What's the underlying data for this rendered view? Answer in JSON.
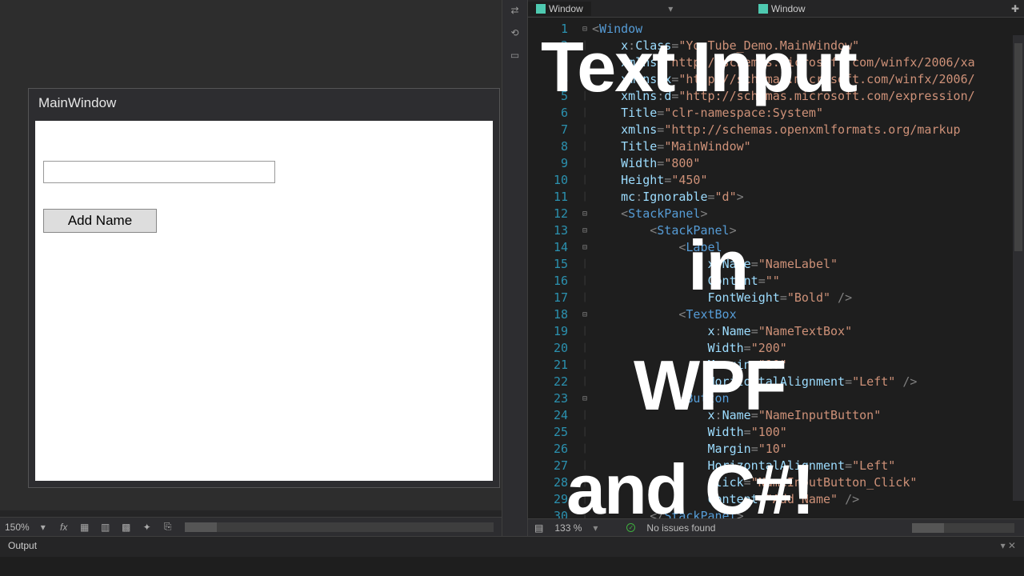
{
  "tabs": {
    "left": "Window",
    "right": "Window"
  },
  "wpf": {
    "title": "MainWindow",
    "button_label": "Add Name"
  },
  "designer_status": {
    "zoom": "150%"
  },
  "code_status": {
    "zoom": "133 %",
    "issues": "No issues found"
  },
  "bottom": {
    "label": "Output"
  },
  "overlay": {
    "line1": "Text Input",
    "line2": "in",
    "line3": "WPF",
    "line4": "and C#!"
  },
  "code": {
    "lines": [
      {
        "n": 1,
        "fold": "⊟",
        "seg": [
          [
            "<",
            "punc"
          ],
          [
            "Window",
            "tag"
          ]
        ]
      },
      {
        "n": 2,
        "seg": [
          [
            "    ",
            ""
          ],
          [
            "x",
            "attr"
          ],
          [
            ":",
            "punc"
          ],
          [
            "Class",
            "attr"
          ],
          [
            "=",
            "punc"
          ],
          [
            "\"YouTube_Demo.MainWindow\"",
            "str"
          ]
        ]
      },
      {
        "n": 3,
        "seg": [
          [
            "    ",
            ""
          ],
          [
            "xmlns",
            "attr"
          ],
          [
            "=",
            "punc"
          ],
          [
            "\"http://schemas.microsoft.com/winfx/2006/xa",
            "str"
          ]
        ]
      },
      {
        "n": 4,
        "seg": [
          [
            "    ",
            ""
          ],
          [
            "xmlns",
            "attr"
          ],
          [
            ":",
            "punc"
          ],
          [
            "x",
            "attr"
          ],
          [
            "=",
            "punc"
          ],
          [
            "\"http://schemas.microsoft.com/winfx/2006/",
            "str"
          ]
        ]
      },
      {
        "n": 5,
        "seg": [
          [
            "    ",
            ""
          ],
          [
            "xmlns",
            "attr"
          ],
          [
            ":",
            "punc"
          ],
          [
            "d",
            "attr"
          ],
          [
            "=",
            "punc"
          ],
          [
            "\"http://schemas.microsoft.com/expression/",
            "str"
          ]
        ]
      },
      {
        "n": 6,
        "seg": [
          [
            "    ",
            ""
          ],
          [
            "Title",
            "attr"
          ],
          [
            "=",
            "punc"
          ],
          [
            "\"clr-namespace:System\"",
            "str"
          ]
        ]
      },
      {
        "n": 7,
        "seg": [
          [
            "    ",
            ""
          ],
          [
            "xmlns",
            "attr"
          ],
          [
            "=",
            "punc"
          ],
          [
            "\"http://schemas.openxmlformats.org/markup",
            "str"
          ]
        ]
      },
      {
        "n": 8,
        "seg": [
          [
            "    ",
            ""
          ],
          [
            "Title",
            "attr"
          ],
          [
            "=",
            "punc"
          ],
          [
            "\"MainWindow\"",
            "str"
          ]
        ]
      },
      {
        "n": 9,
        "seg": [
          [
            "    ",
            ""
          ],
          [
            "Width",
            "attr"
          ],
          [
            "=",
            "punc"
          ],
          [
            "\"800\"",
            "str"
          ]
        ]
      },
      {
        "n": 10,
        "seg": [
          [
            "    ",
            ""
          ],
          [
            "Height",
            "attr"
          ],
          [
            "=",
            "punc"
          ],
          [
            "\"450\"",
            "str"
          ]
        ]
      },
      {
        "n": 11,
        "seg": [
          [
            "    ",
            ""
          ],
          [
            "mc",
            "attr"
          ],
          [
            ":",
            "punc"
          ],
          [
            "Ignorable",
            "attr"
          ],
          [
            "=",
            "punc"
          ],
          [
            "\"d\"",
            "str"
          ],
          [
            ">",
            "punc"
          ]
        ]
      },
      {
        "n": 12,
        "fold": "⊟",
        "seg": [
          [
            "    ",
            ""
          ],
          [
            "<",
            "punc"
          ],
          [
            "StackPanel",
            "tag"
          ],
          [
            ">",
            "punc"
          ]
        ]
      },
      {
        "n": 13,
        "fold": "⊟",
        "seg": [
          [
            "        ",
            ""
          ],
          [
            "<",
            "punc"
          ],
          [
            "StackPanel",
            "tag"
          ],
          [
            ">",
            "punc"
          ]
        ]
      },
      {
        "n": 14,
        "fold": "⊟",
        "seg": [
          [
            "            ",
            ""
          ],
          [
            "<",
            "punc"
          ],
          [
            "Label",
            "tag"
          ]
        ]
      },
      {
        "n": 15,
        "seg": [
          [
            "                ",
            ""
          ],
          [
            "x",
            "attr"
          ],
          [
            ":",
            "punc"
          ],
          [
            "Name",
            "attr"
          ],
          [
            "=",
            "punc"
          ],
          [
            "\"NameLabel\"",
            "str"
          ]
        ]
      },
      {
        "n": 16,
        "seg": [
          [
            "                ",
            ""
          ],
          [
            "Content",
            "attr"
          ],
          [
            "=",
            "punc"
          ],
          [
            "\"\"",
            "str"
          ]
        ]
      },
      {
        "n": 17,
        "seg": [
          [
            "                ",
            ""
          ],
          [
            "FontWeight",
            "attr"
          ],
          [
            "=",
            "punc"
          ],
          [
            "\"Bold\"",
            "str"
          ],
          [
            " />",
            "punc"
          ]
        ]
      },
      {
        "n": 18,
        "fold": "⊟",
        "seg": [
          [
            "            ",
            ""
          ],
          [
            "<",
            "punc"
          ],
          [
            "TextBox",
            "tag"
          ]
        ]
      },
      {
        "n": 19,
        "seg": [
          [
            "                ",
            ""
          ],
          [
            "x",
            "attr"
          ],
          [
            ":",
            "punc"
          ],
          [
            "Name",
            "attr"
          ],
          [
            "=",
            "punc"
          ],
          [
            "\"NameTextBox\"",
            "str"
          ]
        ]
      },
      {
        "n": 20,
        "seg": [
          [
            "                ",
            ""
          ],
          [
            "Width",
            "attr"
          ],
          [
            "=",
            "punc"
          ],
          [
            "\"200\"",
            "str"
          ]
        ]
      },
      {
        "n": 21,
        "seg": [
          [
            "                ",
            ""
          ],
          [
            "Margin",
            "attr"
          ],
          [
            "=",
            "punc"
          ],
          [
            "\"10\"",
            "str"
          ]
        ]
      },
      {
        "n": 22,
        "seg": [
          [
            "                ",
            ""
          ],
          [
            "HorizontalAlignment",
            "attr"
          ],
          [
            "=",
            "punc"
          ],
          [
            "\"Left\"",
            "str"
          ],
          [
            " />",
            "punc"
          ]
        ]
      },
      {
        "n": 23,
        "fold": "⊟",
        "seg": [
          [
            "            ",
            ""
          ],
          [
            "<",
            "punc"
          ],
          [
            "Button",
            "tag"
          ]
        ]
      },
      {
        "n": 24,
        "seg": [
          [
            "                ",
            ""
          ],
          [
            "x",
            "attr"
          ],
          [
            ":",
            "punc"
          ],
          [
            "Name",
            "attr"
          ],
          [
            "=",
            "punc"
          ],
          [
            "\"NameInputButton\"",
            "str"
          ]
        ]
      },
      {
        "n": 25,
        "seg": [
          [
            "                ",
            ""
          ],
          [
            "Width",
            "attr"
          ],
          [
            "=",
            "punc"
          ],
          [
            "\"100\"",
            "str"
          ]
        ]
      },
      {
        "n": 26,
        "seg": [
          [
            "                ",
            ""
          ],
          [
            "Margin",
            "attr"
          ],
          [
            "=",
            "punc"
          ],
          [
            "\"10\"",
            "str"
          ]
        ]
      },
      {
        "n": 27,
        "seg": [
          [
            "                ",
            ""
          ],
          [
            "HorizontalAlignment",
            "attr"
          ],
          [
            "=",
            "punc"
          ],
          [
            "\"Left\"",
            "str"
          ]
        ]
      },
      {
        "n": 28,
        "seg": [
          [
            "                ",
            ""
          ],
          [
            "Click",
            "attr"
          ],
          [
            "=",
            "punc"
          ],
          [
            "\"NameInputButton_Click\"",
            "str"
          ]
        ]
      },
      {
        "n": 29,
        "seg": [
          [
            "                ",
            ""
          ],
          [
            "Content",
            "attr"
          ],
          [
            "=",
            "punc"
          ],
          [
            "\"Add Name\"",
            "str"
          ],
          [
            " />",
            "punc"
          ]
        ]
      },
      {
        "n": 30,
        "seg": [
          [
            "        ",
            ""
          ],
          [
            "</",
            "punc"
          ],
          [
            "StackPanel",
            "tag"
          ],
          [
            ">",
            "punc"
          ]
        ]
      }
    ]
  }
}
